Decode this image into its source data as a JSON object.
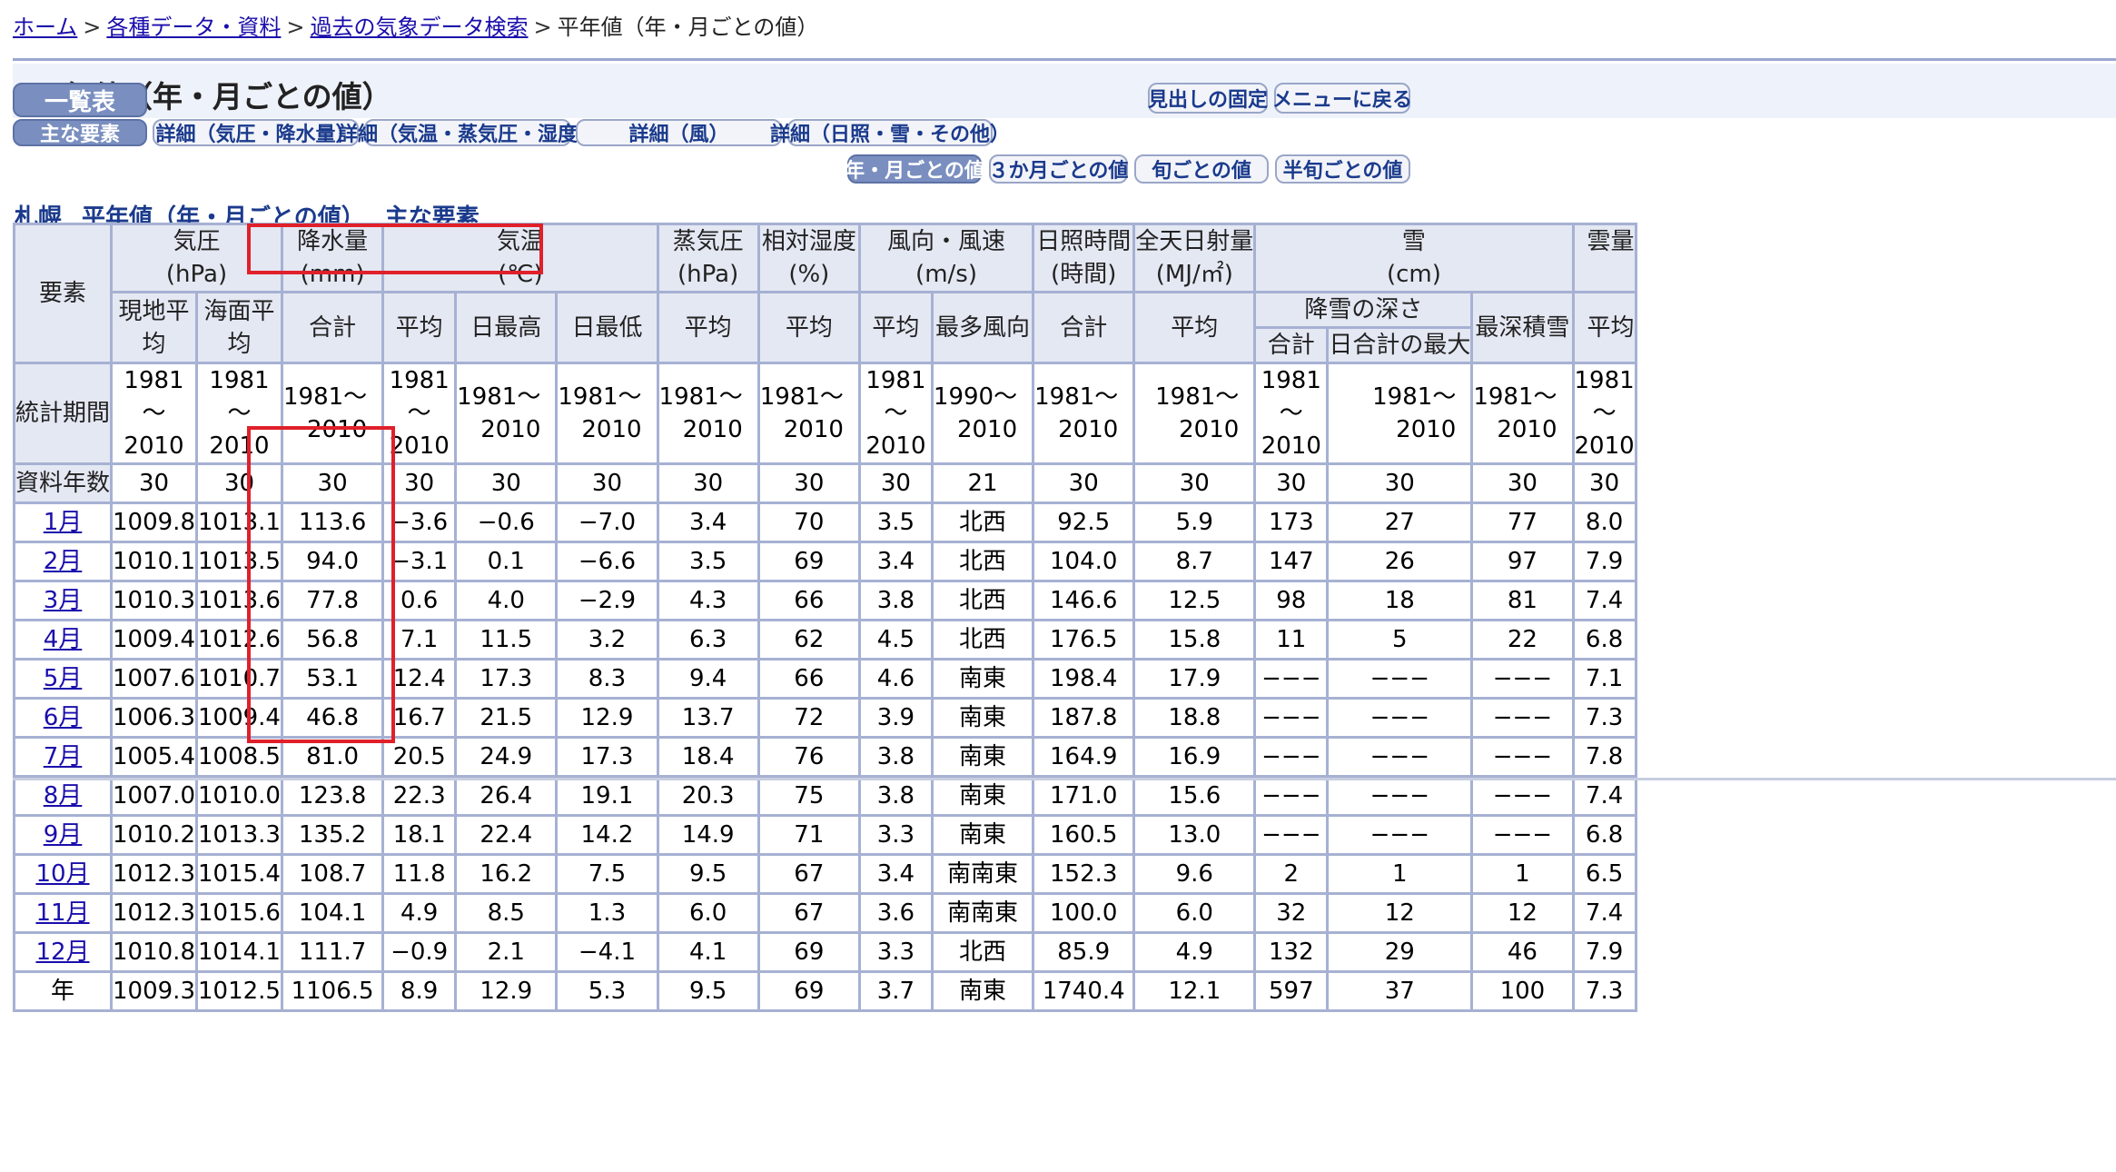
{
  "breadcrumb": {
    "home": "ホーム",
    "data": "各種データ・資料",
    "search": "過去の気象データ検索",
    "current": "平年値（年・月ごとの値）",
    "separator": ">"
  },
  "page_title": "平年値（年・月ごとの値）",
  "buttons": {
    "list": "一覧表",
    "fix_header": "見出しの固定",
    "back_menu": "メニューに戻る",
    "main": "主な要素",
    "detail_pressure": "詳細（気圧・降水量）",
    "detail_temp": "詳細（気温・蒸気圧・湿度）",
    "detail_wind": "詳細（風）",
    "detail_sun": "詳細（日照・雪・その他）",
    "per_month": "年・月ごとの値",
    "per_3month": "３か月ごとの値",
    "per_jun": "旬ごとの値",
    "per_hanjun": "半旬ごとの値"
  },
  "subtitle": {
    "station": "札幌",
    "desc": "平年値（年・月ごとの値）",
    "kind": "主な要素"
  },
  "table": {
    "h_element": "要素",
    "h_pressure": "気圧",
    "u_pressure": "(hPa)",
    "h_precip": "降水量",
    "u_precip": "(mm)",
    "h_temp": "気温",
    "u_temp": "(℃)",
    "h_vapor": "蒸気圧",
    "u_vapor": "(hPa)",
    "h_humid": "相対湿度",
    "u_humid": "(%)",
    "h_wind": "風向・風速",
    "u_wind": "(m/s)",
    "h_sunshine": "日照時間",
    "u_sunshine": "(時間)",
    "h_radiation": "全天日射量",
    "u_radiation": "(MJ/㎡)",
    "h_snow": "雪",
    "u_snow": "(cm)",
    "h_cloud": "雲量",
    "s_station_avg": "現地平均",
    "s_sea_avg": "海面平均",
    "s_total": "合計",
    "s_avg": "平均",
    "s_max": "日最高",
    "s_min": "日最低",
    "s_mostdir": "最多風向",
    "s_snowfall": "降雪の深さ",
    "s_snowtotal": "合計",
    "s_snowdaymax": "日合計の最大",
    "s_deepest": "最深積雪",
    "period_label": "統計期間",
    "p_from": "1981",
    "p_from_wind": "1990",
    "p_tilde": "～",
    "p_to": "2010",
    "years_label": "資料年数",
    "years": [
      "30",
      "30",
      "30",
      "30",
      "30",
      "30",
      "30",
      "30",
      "30",
      "21",
      "30",
      "30",
      "30",
      "30",
      "30",
      "30"
    ],
    "rows": [
      {
        "label": "1月",
        "v": [
          "1009.8",
          "1013.1",
          "113.6",
          "−3.6",
          "−0.6",
          "−7.0",
          "3.4",
          "70",
          "3.5",
          "北西",
          "92.5",
          "5.9",
          "173",
          "27",
          "77",
          "8.0"
        ]
      },
      {
        "label": "2月",
        "v": [
          "1010.1",
          "1013.5",
          "94.0",
          "−3.1",
          "0.1",
          "−6.6",
          "3.5",
          "69",
          "3.4",
          "北西",
          "104.0",
          "8.7",
          "147",
          "26",
          "97",
          "7.9"
        ]
      },
      {
        "label": "3月",
        "v": [
          "1010.3",
          "1013.6",
          "77.8",
          "0.6",
          "4.0",
          "−2.9",
          "4.3",
          "66",
          "3.8",
          "北西",
          "146.6",
          "12.5",
          "98",
          "18",
          "81",
          "7.4"
        ]
      },
      {
        "label": "4月",
        "v": [
          "1009.4",
          "1012.6",
          "56.8",
          "7.1",
          "11.5",
          "3.2",
          "6.3",
          "62",
          "4.5",
          "北西",
          "176.5",
          "15.8",
          "11",
          "5",
          "22",
          "6.8"
        ]
      },
      {
        "label": "5月",
        "v": [
          "1007.6",
          "1010.7",
          "53.1",
          "12.4",
          "17.3",
          "8.3",
          "9.4",
          "66",
          "4.6",
          "南東",
          "198.4",
          "17.9",
          "−−−",
          "−−−",
          "−−−",
          "7.1"
        ]
      },
      {
        "label": "6月",
        "v": [
          "1006.3",
          "1009.4",
          "46.8",
          "16.7",
          "21.5",
          "12.9",
          "13.7",
          "72",
          "3.9",
          "南東",
          "187.8",
          "18.8",
          "−−−",
          "−−−",
          "−−−",
          "7.3"
        ]
      },
      {
        "label": "7月",
        "v": [
          "1005.4",
          "1008.5",
          "81.0",
          "20.5",
          "24.9",
          "17.3",
          "18.4",
          "76",
          "3.8",
          "南東",
          "164.9",
          "16.9",
          "−−−",
          "−−−",
          "−−−",
          "7.8"
        ]
      },
      {
        "label": "8月",
        "v": [
          "1007.0",
          "1010.0",
          "123.8",
          "22.3",
          "26.4",
          "19.1",
          "20.3",
          "75",
          "3.8",
          "南東",
          "171.0",
          "15.6",
          "−−−",
          "−−−",
          "−−−",
          "7.4"
        ]
      },
      {
        "label": "9月",
        "v": [
          "1010.2",
          "1013.3",
          "135.2",
          "18.1",
          "22.4",
          "14.2",
          "14.9",
          "71",
          "3.3",
          "南東",
          "160.5",
          "13.0",
          "−−−",
          "−−−",
          "−−−",
          "6.8"
        ]
      },
      {
        "label": "10月",
        "v": [
          "1012.3",
          "1015.4",
          "108.7",
          "11.8",
          "16.2",
          "7.5",
          "9.5",
          "67",
          "3.4",
          "南南東",
          "152.3",
          "9.6",
          "2",
          "1",
          "1",
          "6.5"
        ]
      },
      {
        "label": "11月",
        "v": [
          "1012.3",
          "1015.6",
          "104.1",
          "4.9",
          "8.5",
          "1.3",
          "6.0",
          "67",
          "3.6",
          "南南東",
          "100.0",
          "6.0",
          "32",
          "12",
          "12",
          "7.4"
        ]
      },
      {
        "label": "12月",
        "v": [
          "1010.8",
          "1014.1",
          "111.7",
          "−0.9",
          "2.1",
          "−4.1",
          "4.1",
          "69",
          "3.3",
          "北西",
          "85.9",
          "4.9",
          "132",
          "29",
          "46",
          "7.9"
        ]
      }
    ],
    "year_row": {
      "label": "年",
      "v": [
        "1009.3",
        "1012.5",
        "1106.5",
        "8.9",
        "12.9",
        "5.3",
        "9.5",
        "69",
        "3.7",
        "南東",
        "1740.4",
        "12.1",
        "597",
        "37",
        "100",
        "7.3"
      ]
    }
  }
}
